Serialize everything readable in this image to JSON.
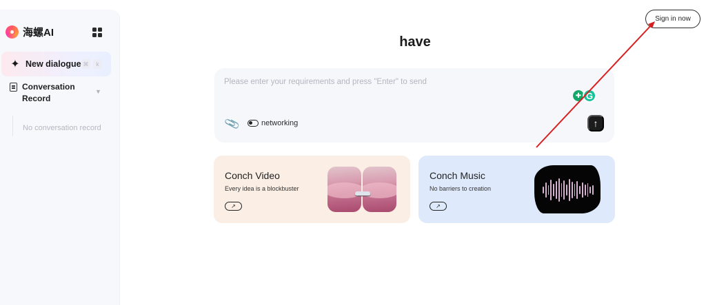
{
  "sidebar": {
    "brand_name": "海螺AI",
    "new_dialogue_label": "New dialogue",
    "kbd_1": "⌘",
    "kbd_2": "k",
    "conversation_record_label": "Conversation Record",
    "no_conversation_text": "No conversation record"
  },
  "header": {
    "sign_in_label": "Sign in now"
  },
  "main": {
    "heading": "have",
    "input": {
      "placeholder": "Please enter your requirements and press \"Enter\" to send",
      "networking_label": "networking",
      "send_glyph": "↑"
    },
    "cards": [
      {
        "title": "Conch Video",
        "description": "Every idea is a blockbuster",
        "arrow": "↗"
      },
      {
        "title": "Conch Music",
        "description": "No barriers to creation",
        "arrow": "↗"
      }
    ]
  },
  "icons": {
    "ext_a": "✚",
    "ext_g": "G"
  },
  "colors": {
    "sidebar_bg": "#f7f8fc",
    "video_card_bg": "#fbeee4",
    "music_card_bg": "#deeafc",
    "send_button_bg": "#1c1c1c"
  }
}
